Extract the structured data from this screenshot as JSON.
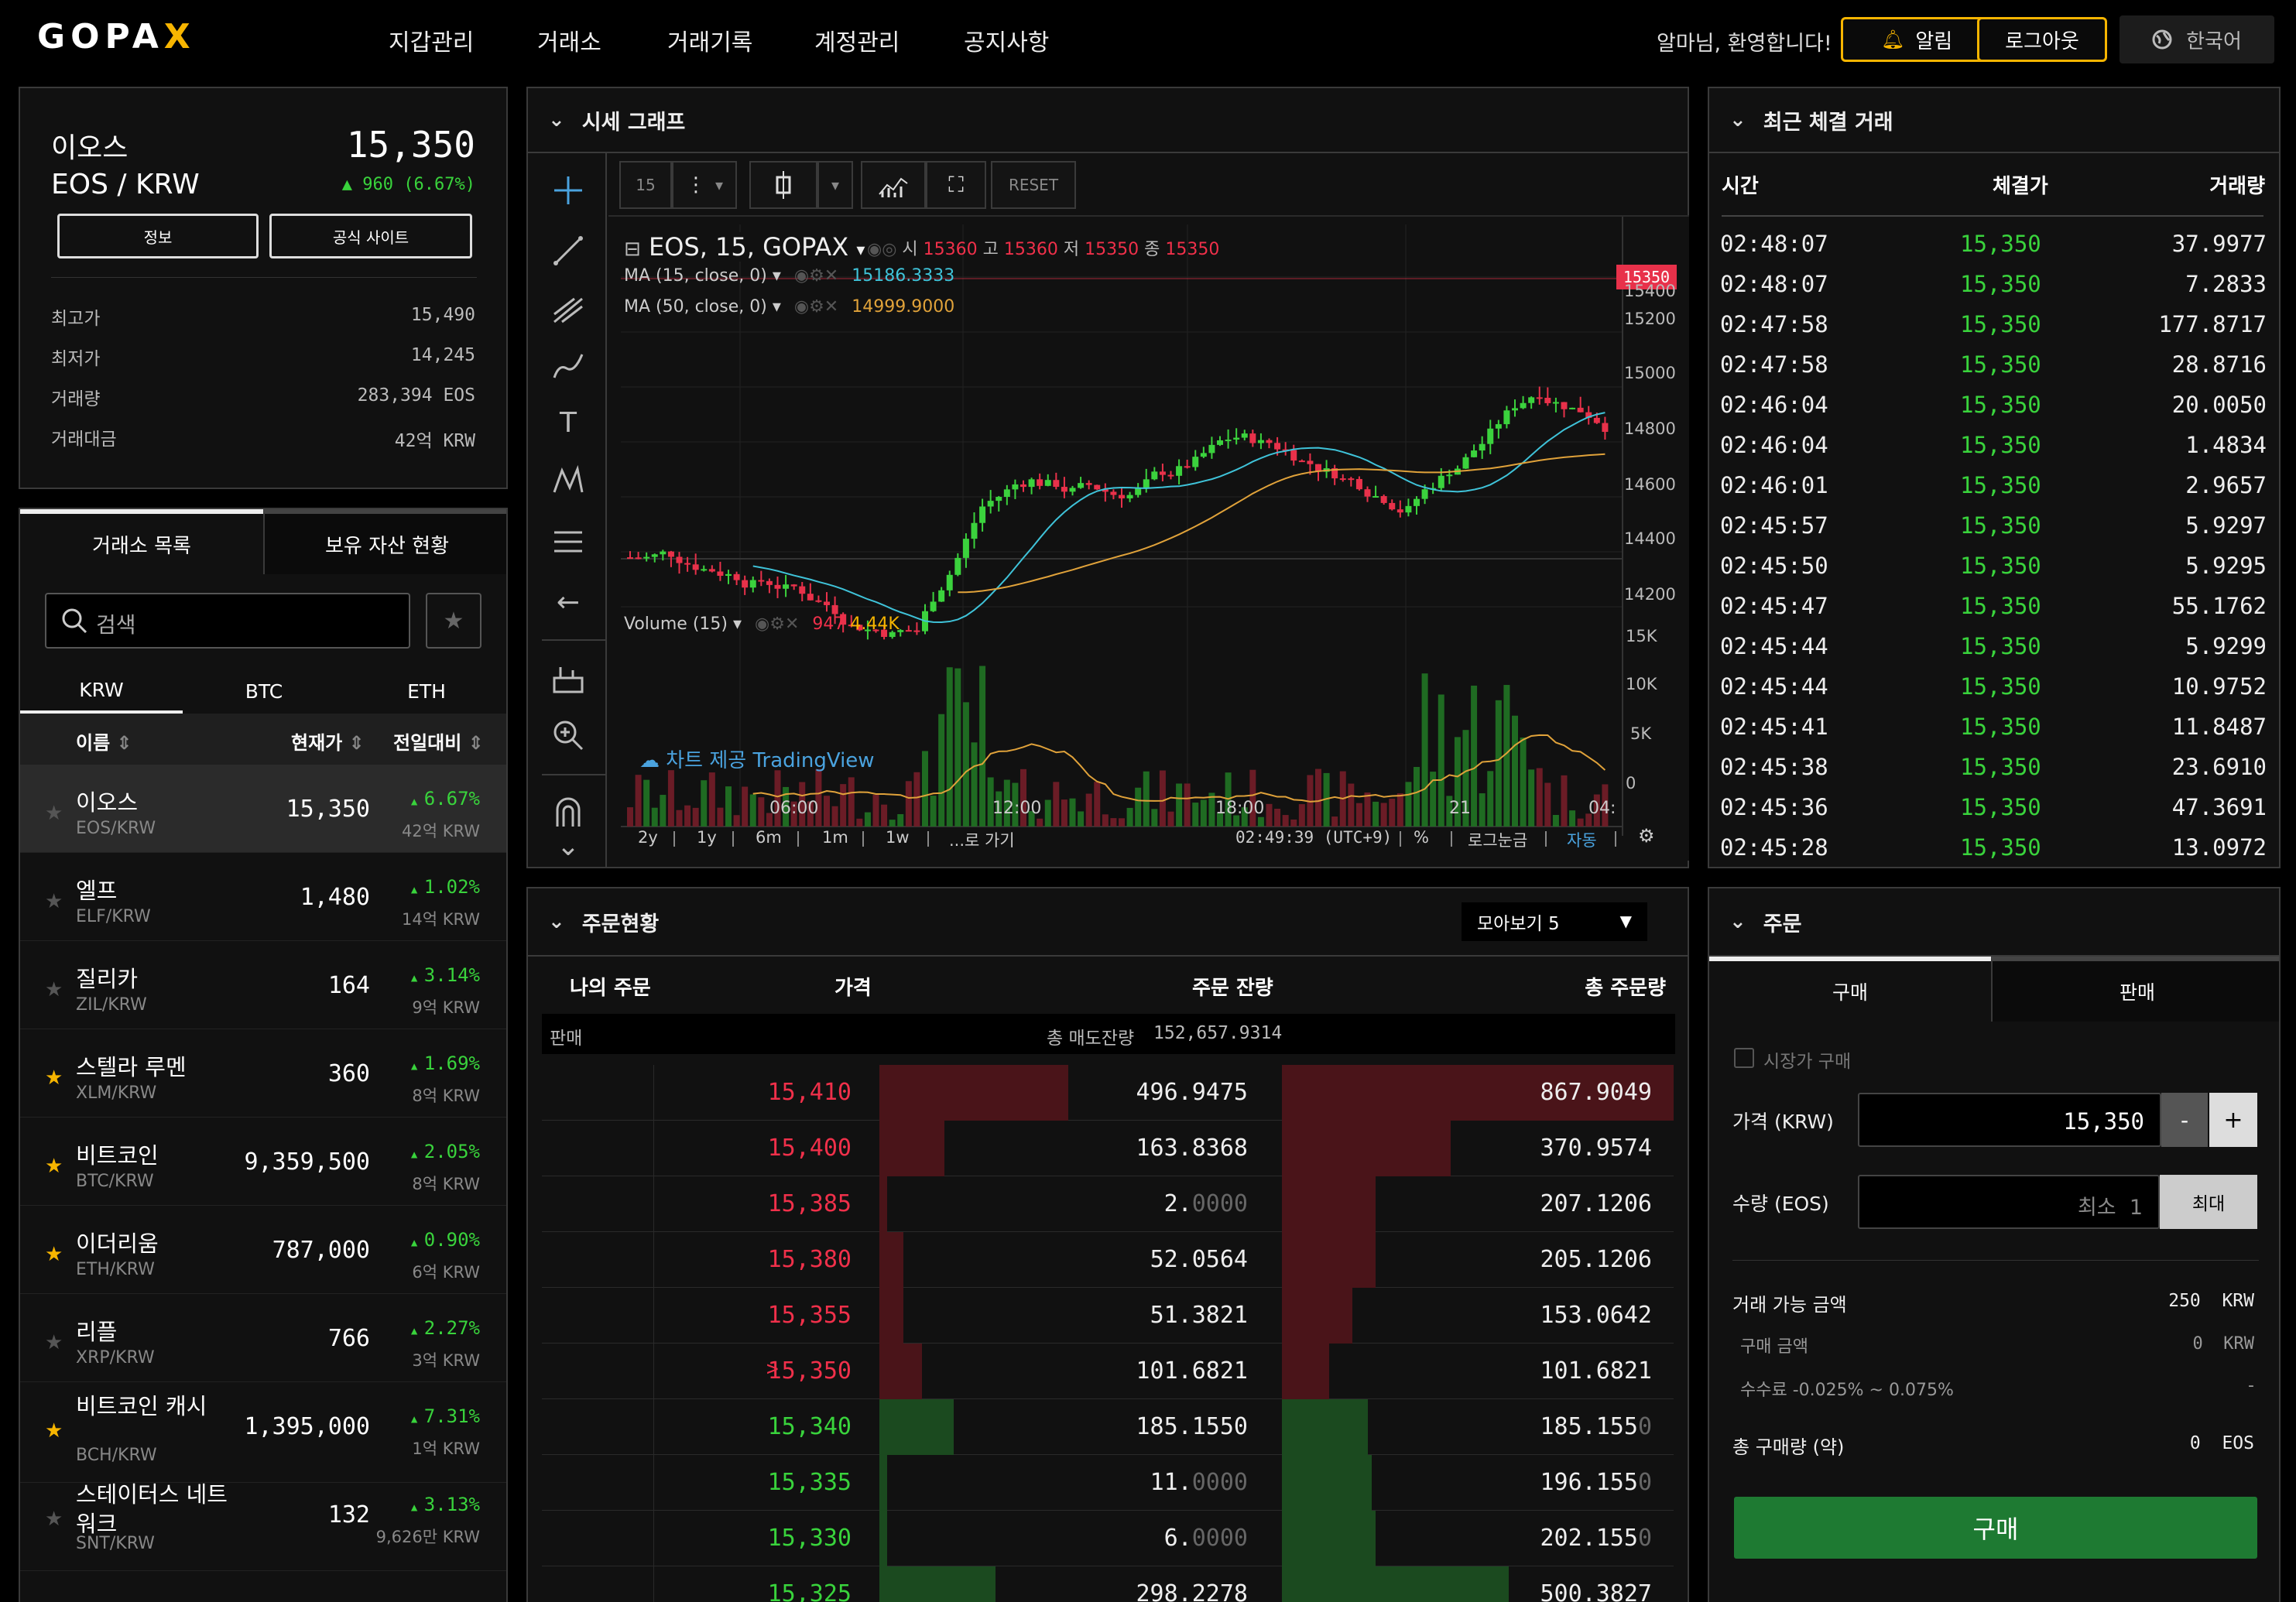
{
  "header": {
    "logo": "GOPAX",
    "nav": [
      "지갑관리",
      "거래소",
      "거래기록",
      "계정관리",
      "공지사항"
    ],
    "active_nav": "거래소",
    "welcome": "알마님, 환영합니다!",
    "alarm_label": "알림",
    "logout_label": "로그아웃",
    "language_label": "한국어"
  },
  "coin": {
    "name": "이오스",
    "pair": "EOS / KRW",
    "price": "15,350",
    "change": "960 (6.67%)",
    "info_label": "정보",
    "site_label": "공식 사이트",
    "stats": [
      {
        "label": "최고가",
        "value": "15,490"
      },
      {
        "label": "최저가",
        "value": "14,245"
      },
      {
        "label": "거래량",
        "value": "283,394 EOS"
      },
      {
        "label": "거래대금",
        "value": "42억 KRW"
      }
    ]
  },
  "market": {
    "tabs": [
      "거래소 목록",
      "보유 자산 현황"
    ],
    "search_placeholder": "검색",
    "base_tabs": [
      "KRW",
      "BTC",
      "ETH"
    ],
    "columns": [
      "이름",
      "현재가",
      "전일대비"
    ],
    "rows": [
      {
        "name": "이오스",
        "pair": "EOS/KRW",
        "price": "15,350",
        "change": "6.67%",
        "volume": "42억 KRW",
        "fav": false,
        "selected": true
      },
      {
        "name": "엘프",
        "pair": "ELF/KRW",
        "price": "1,480",
        "change": "1.02%",
        "volume": "14억 KRW",
        "fav": false
      },
      {
        "name": "질리카",
        "pair": "ZIL/KRW",
        "price": "164",
        "change": "3.14%",
        "volume": "9억 KRW",
        "fav": false
      },
      {
        "name": "스텔라 루멘",
        "pair": "XLM/KRW",
        "price": "360",
        "change": "1.69%",
        "volume": "8억 KRW",
        "fav": true
      },
      {
        "name": "비트코인",
        "pair": "BTC/KRW",
        "price": "9,359,500",
        "change": "2.05%",
        "volume": "8억 KRW",
        "fav": true
      },
      {
        "name": "이더리움",
        "pair": "ETH/KRW",
        "price": "787,000",
        "change": "0.90%",
        "volume": "6억 KRW",
        "fav": true
      },
      {
        "name": "리플",
        "pair": "XRP/KRW",
        "price": "766",
        "change": "2.27%",
        "volume": "3억 KRW",
        "fav": false
      },
      {
        "name": "비트코인 캐시",
        "pair": "BCH/KRW",
        "price": "1,395,000",
        "change": "7.31%",
        "volume": "1억 KRW",
        "fav": true
      },
      {
        "name": "스테이터스 네트워크",
        "pair": "SNT/KRW",
        "price": "132",
        "change": "3.13%",
        "volume": "9,626만 KRW",
        "fav": false
      }
    ]
  },
  "chart": {
    "panel_title": "시세 그래프",
    "interval": "15",
    "reset_label": "RESET",
    "symbol": "EOS, 15, GOPAX",
    "ohlc": {
      "o_label": "시",
      "o": "15360",
      "h_label": "고",
      "h": "15360",
      "l_label": "저",
      "l": "15350",
      "c_label": "종",
      "c": "15350"
    },
    "ma15_label": "MA (15, close, 0)",
    "ma15_value": "15186.3333",
    "ma50_label": "MA (50, close, 0)",
    "ma50_value": "14999.9000",
    "price_tag": "15350",
    "price_axis": [
      "15400",
      "15200",
      "15000",
      "14800",
      "14600",
      "14400",
      "14200"
    ],
    "volume_label": "Volume (15)",
    "volume_values": [
      "947",
      "4.44K"
    ],
    "volume_axis": [
      "15K",
      "10K",
      "5K",
      "0"
    ],
    "x_axis": [
      "06:00",
      "12:00",
      "18:00",
      "21",
      "04:"
    ],
    "watermark": "차트 제공 TradingView",
    "ranges": [
      "2y",
      "1y",
      "6m",
      "1m",
      "1w",
      "...로 가기"
    ],
    "time": "02:49:39 (UTC+9)",
    "opts": [
      "%",
      "로그눈금",
      "자동"
    ],
    "colors": {
      "up": "#3bd23d",
      "down": "#e8314a",
      "ma15": "#3fc3d9",
      "ma50": "#e0a23a"
    }
  },
  "trades": {
    "title": "최근 체결 거래",
    "columns": [
      "시간",
      "체결가",
      "거래량"
    ],
    "rows": [
      {
        "time": "02:48:07",
        "price": "15,350",
        "vol": "37.9977"
      },
      {
        "time": "02:48:07",
        "price": "15,350",
        "vol": "7.2833"
      },
      {
        "time": "02:47:58",
        "price": "15,350",
        "vol": "177.8717"
      },
      {
        "time": "02:47:58",
        "price": "15,350",
        "vol": "28.8716"
      },
      {
        "time": "02:46:04",
        "price": "15,350",
        "vol": "20.0050"
      },
      {
        "time": "02:46:04",
        "price": "15,350",
        "vol": "1.4834"
      },
      {
        "time": "02:46:01",
        "price": "15,350",
        "vol": "2.9657"
      },
      {
        "time": "02:45:57",
        "price": "15,350",
        "vol": "5.9297"
      },
      {
        "time": "02:45:50",
        "price": "15,350",
        "vol": "5.9295"
      },
      {
        "time": "02:45:47",
        "price": "15,350",
        "vol": "55.1762"
      },
      {
        "time": "02:45:44",
        "price": "15,350",
        "vol": "5.9299"
      },
      {
        "time": "02:45:44",
        "price": "15,350",
        "vol": "10.9752"
      },
      {
        "time": "02:45:41",
        "price": "15,350",
        "vol": "11.8487"
      },
      {
        "time": "02:45:38",
        "price": "15,350",
        "vol": "23.6910"
      },
      {
        "time": "02:45:36",
        "price": "15,350",
        "vol": "47.3691"
      },
      {
        "time": "02:45:28",
        "price": "15,350",
        "vol": "13.0972"
      }
    ]
  },
  "orderbook": {
    "title": "주문현황",
    "grouping": "모아보기 5",
    "columns": [
      "나의 주문",
      "가격",
      "주문 잔량",
      "총 주문량"
    ],
    "sell_label": "판매",
    "total_sell_label": "총 매도잔량",
    "total_sell": "152,657.9314",
    "current_marker": ">",
    "asks": [
      {
        "price": "15,410",
        "qty": "496.9475",
        "total": "867.9049",
        "qfill": 0.58,
        "tfill": 1.0
      },
      {
        "price": "15,400",
        "qty": "163.8368",
        "total": "370.9574",
        "qfill": 0.19,
        "tfill": 0.43
      },
      {
        "price": "15,385",
        "qty": "2.0000",
        "total": "207.1206",
        "qfill": 0.01,
        "tfill": 0.24
      },
      {
        "price": "15,380",
        "qty": "52.0564",
        "total": "205.1206",
        "qfill": 0.06,
        "tfill": 0.24
      },
      {
        "price": "15,355",
        "qty": "51.3821",
        "total": "153.0642",
        "qfill": 0.06,
        "tfill": 0.18
      },
      {
        "price": "15,350",
        "qty": "101.6821",
        "total": "101.6821",
        "qfill": 0.12,
        "tfill": 0.12,
        "current": true
      }
    ],
    "bids": [
      {
        "price": "15,340",
        "qty": "185.1550",
        "total": "185.1550",
        "qfill": 0.22,
        "tfill": 0.22
      },
      {
        "price": "15,335",
        "qty": "11.0000",
        "total": "196.1550",
        "qfill": 0.01,
        "tfill": 0.23
      },
      {
        "price": "15,330",
        "qty": "6.0000",
        "total": "202.1550",
        "qfill": 0.01,
        "tfill": 0.24
      },
      {
        "price": "15,325",
        "qty": "298.2278",
        "total": "500.3827",
        "qfill": 0.35,
        "tfill": 0.58
      }
    ]
  },
  "order": {
    "title": "주문",
    "tabs": [
      "구매",
      "판매"
    ],
    "market_order_label": "시장가 구매",
    "price_label": "가격 (KRW)",
    "price_value": "15,350",
    "minus": "-",
    "plus": "+",
    "qty_label": "수량 (EOS)",
    "qty_placeholder": "최소  1",
    "max_label": "최대",
    "available_label": "거래 가능 금액",
    "available_value": "250  KRW",
    "buy_amount_label": "구매 금액",
    "buy_amount_value": "0  KRW",
    "fee_label": "수수료 -0.025% ~ 0.075%",
    "fee_value": "-",
    "total_label": "총 구매량 (약)",
    "total_value": "0  EOS",
    "buy_button": "구매"
  }
}
